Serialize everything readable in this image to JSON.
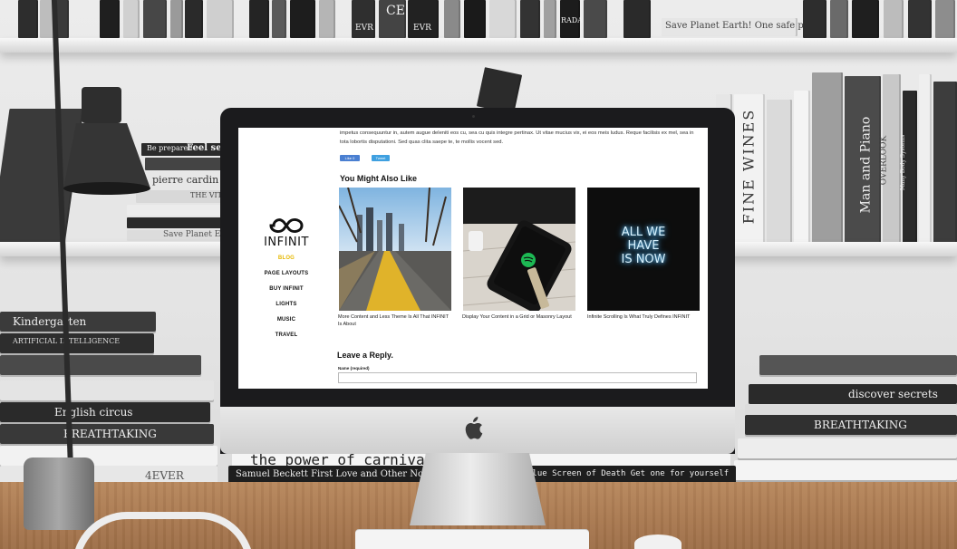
{
  "site": {
    "brand": "INFINIT",
    "nav": [
      "BLOG",
      "PAGE LAYOUTS",
      "BUY INFINIT",
      "LIGHTS",
      "MUSIC",
      "TRAVEL"
    ],
    "active_nav": "BLOG"
  },
  "post": {
    "paragraph": "impetus consequuntur in, autem augue deleniti eos cu, sea cu quis integre pertinax. Ut vitae mucius vix, ei eos meis ludus. Reque facilisis ex mel, sea in tota lobortis disputationi. Sed quas clita saepe te, te mollis vocent sed.",
    "share_facebook": "Like 0",
    "share_twitter": "Tweet"
  },
  "related": {
    "heading": "You Might Also Like",
    "cards": [
      {
        "caption": "More Content and Less Theme Is All That INFINIT Is About"
      },
      {
        "caption": "Display Your Content in a Grid or Masonry Layout"
      },
      {
        "caption": "Infinite Scrolling Is What Truly Defines INFINIT",
        "image_text": [
          "ALL WE",
          "HAVE",
          "IS NOW"
        ]
      }
    ]
  },
  "reply": {
    "heading": "Leave a Reply.",
    "name_label": "Name (required)",
    "name_value": ""
  },
  "background": {
    "shelf_top_titles": [
      "EVR",
      "CE",
      "EVR",
      "RADA",
      "Save Planet Earth! One safe place"
    ],
    "shelf_mid_left": [
      "Be prepared",
      "Feel secure",
      "pierre cardin",
      "THE VITTIR",
      "Save Planet Earth"
    ],
    "shelf_mid_right": [
      "FINE WINES",
      "Man and Piano",
      "OVERLOOK",
      "Many Body Systems"
    ],
    "stack_left": [
      "Kindergarten",
      "ARTIFICIAL INTELLIGENCE",
      "English circus",
      "BREATHTAKING"
    ],
    "stack_right": [
      "discover secrets",
      "BREATHTAKING"
    ],
    "desk_books": [
      "the power of carnival",
      "Samuel Beckett First Love and Other Novellas",
      "Blue Screen of Death Get one for yourself",
      "4EVER"
    ]
  },
  "colors": {
    "accent_nav": "#e6b800",
    "screen_bezel": "#1b1b1d",
    "share_blue": "#4a7fd1"
  }
}
